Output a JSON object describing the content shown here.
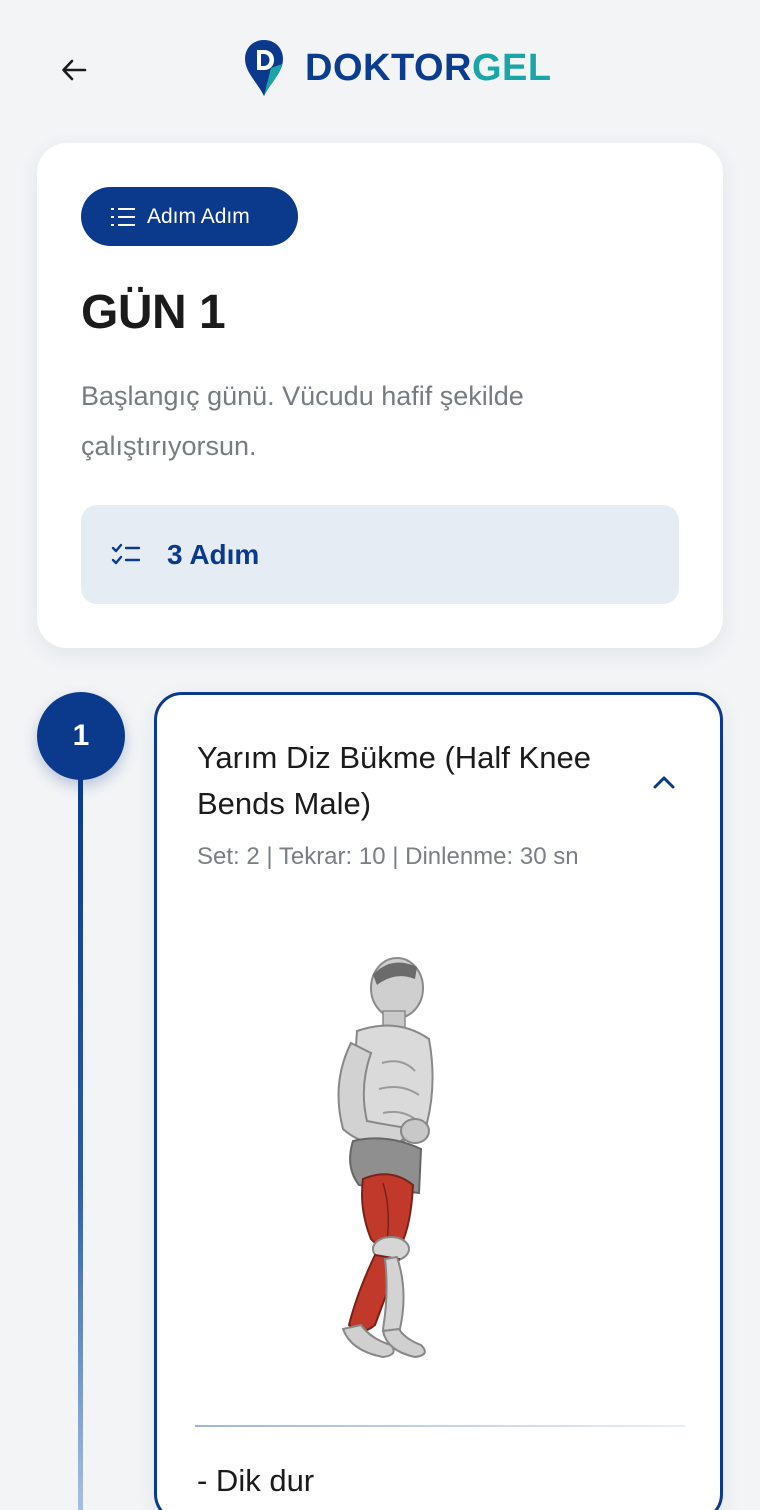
{
  "header": {
    "back_icon": "arrow-left-icon",
    "logo_icon": "location-pin-d-icon",
    "logo_text_main": "DOKTOR",
    "logo_text_accent": "GEL",
    "colors": {
      "brand": "#0b3a8c",
      "accent": "#1aa6a6"
    }
  },
  "summary": {
    "pill_icon": "numbered-list-icon",
    "pill_label": "Adım Adım",
    "day_title": "GÜN 1",
    "description": "Başlangıç günü. Vücudu hafif şekilde çalıştırıyorsun.",
    "steps_icon": "checklist-icon",
    "steps_label": "3 Adım"
  },
  "timeline": {
    "step_number": "1"
  },
  "exercise": {
    "title": "Yarım Diz Bükme (Half Knee Bends Male)",
    "collapse_icon": "chevron-up-icon",
    "meta": "Set: 2 | Tekrar: 10 | Dinlenme: 30 sn",
    "image_icon": "exercise-illustration",
    "instruction": "- Dik dur"
  }
}
